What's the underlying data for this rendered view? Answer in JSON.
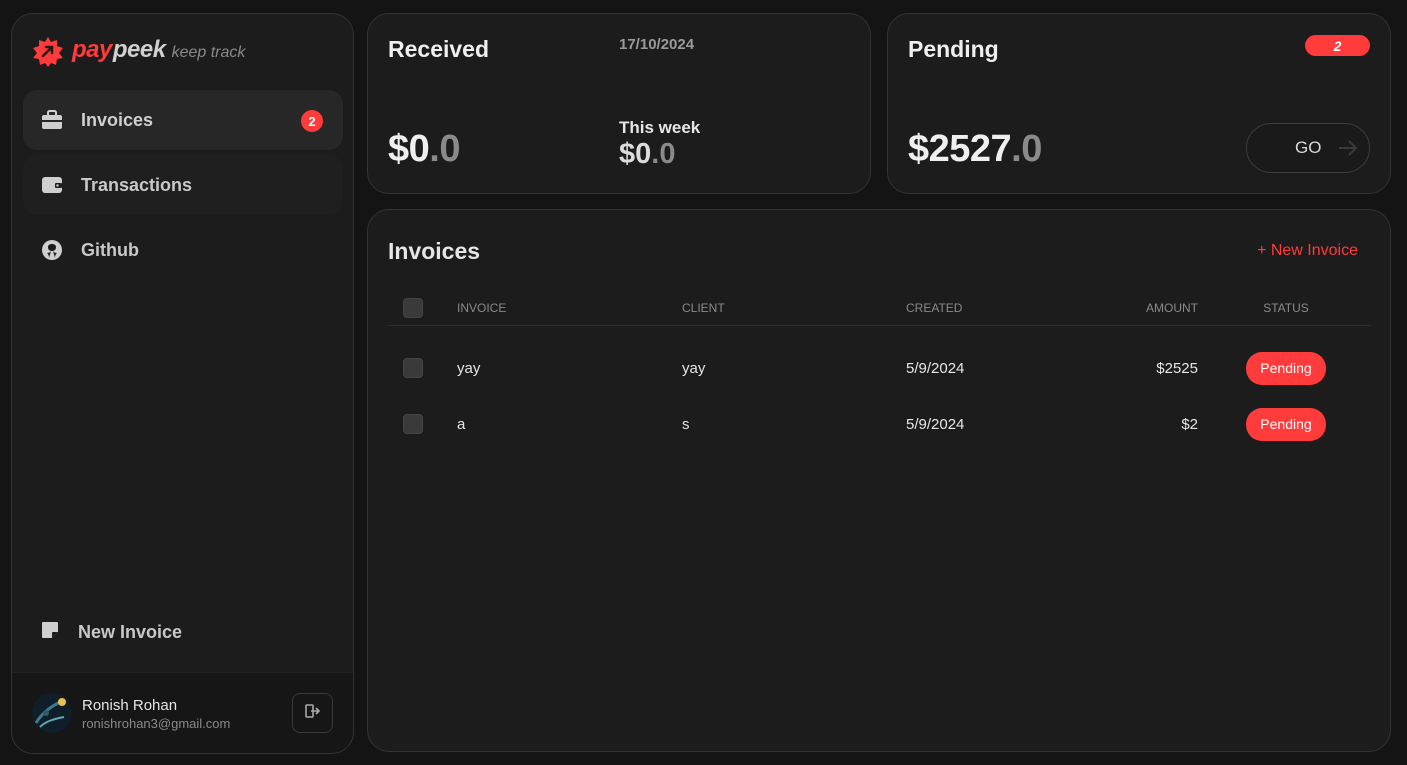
{
  "brand": {
    "pay": "pay",
    "peek": "peek",
    "tagline": "keep track"
  },
  "sidebar": {
    "items": [
      {
        "label": "Invoices",
        "icon": "briefcase-icon",
        "badge": "2"
      },
      {
        "label": "Transactions",
        "icon": "wallet-icon"
      },
      {
        "label": "Github",
        "icon": "github-icon"
      }
    ],
    "new_invoice": "New Invoice"
  },
  "user": {
    "name": "Ronish Rohan",
    "email": "ronishrohan3@gmail.com"
  },
  "received": {
    "title": "Received",
    "date": "17/10/2024",
    "amount_int": "$0",
    "amount_dec": ".0",
    "week_label": "This week",
    "week_int": "$0",
    "week_dec": ".0"
  },
  "pending": {
    "title": "Pending",
    "badge": "2",
    "amount_int": "$2527",
    "amount_dec": ".0",
    "go_label": "GO"
  },
  "invoices": {
    "title": "Invoices",
    "new_label": "+ New Invoice",
    "columns": [
      "INVOICE",
      "CLIENT",
      "CREATED",
      "AMOUNT",
      "STATUS"
    ],
    "rows": [
      {
        "invoice": "yay",
        "client": "yay",
        "created": "5/9/2024",
        "amount": "$2525",
        "status": "Pending"
      },
      {
        "invoice": "a",
        "client": "s",
        "created": "5/9/2024",
        "amount": "$2",
        "status": "Pending"
      }
    ]
  },
  "colors": {
    "accent": "#ff3b3b",
    "background": "#141414",
    "panel": "#1c1c1c"
  }
}
